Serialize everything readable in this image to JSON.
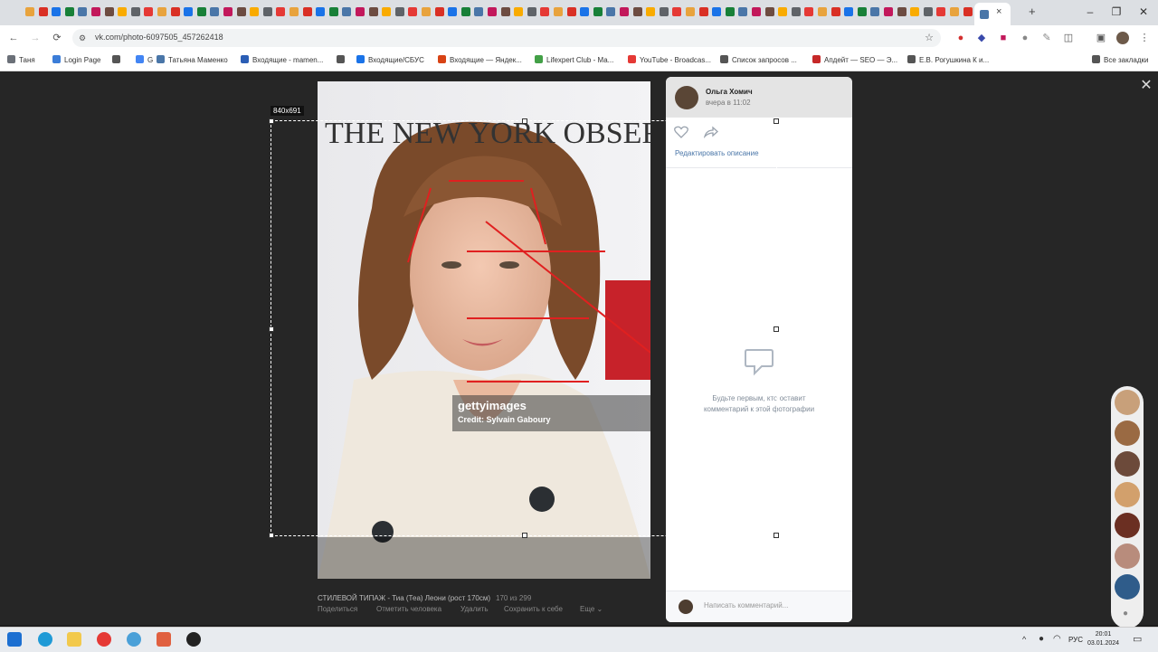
{
  "browser": {
    "url": "vk.com/photo-6097505_457262418",
    "tab_close": "×",
    "new_tab": "+",
    "window_controls": {
      "minimize": "–",
      "maximize": "❐",
      "close": "✕"
    },
    "bookmarks": [
      {
        "label": "Таня",
        "icon_color": "#6b7078"
      },
      {
        "label": "Login Page",
        "icon_color": "#3b7dd8"
      },
      {
        "label": "",
        "icon_color": "#555555"
      },
      {
        "label": "G",
        "icon_color": "#4285f4"
      },
      {
        "label": "Татьяна Маменко",
        "icon_color": "#4a76a8"
      },
      {
        "label": "Входящие - mamen...",
        "icon_color": "#2b5eb5"
      },
      {
        "label": "",
        "icon_color": "#555555"
      },
      {
        "label": "Входящие/СБУС",
        "icon_color": "#1a73e8"
      },
      {
        "label": "Входящие — Яндек...",
        "icon_color": "#d84315"
      },
      {
        "label": "Lifexpert Club - Ма...",
        "icon_color": "#43a047"
      },
      {
        "label": "YouTube - Broadcas...",
        "icon_color": "#e53935"
      },
      {
        "label": "Список запросов ...",
        "icon_color": "#555555"
      },
      {
        "label": "Апдейт — SEO — Э...",
        "icon_color": "#c62828"
      },
      {
        "label": "Е.В. Рогушкина К и...",
        "icon_color": "#555555"
      },
      {
        "label": "Все закладки",
        "icon_color": "#555555"
      }
    ]
  },
  "viewer": {
    "selection_size": "840x691",
    "getty_logo": "gettyimages",
    "getty_credit": "Credit: Sylvain Gaboury",
    "photo_watermark": "THE NEW YORK OBSERVER",
    "caption": "СТИЛЕВОЙ ТИПАЖ - Тиа (Теа) Леони (рост 170см)",
    "counter": "170 из 299",
    "actions": [
      "Поделиться",
      "Отметить человека",
      "Удалить",
      "Сохранить к себе",
      "Еще ⌄"
    ],
    "close": "✕"
  },
  "side_panel": {
    "author": "Ольга Хомич",
    "posted": "вчера в 11:02",
    "edit_description": "Редактировать описание",
    "empty_comments": "Будьте первым, кто оставит комментарий к этой фотографии",
    "comment_placeholder": "Написать комментарий..."
  },
  "taskbar": {
    "lang": "РУС",
    "time": "20:01",
    "date": "03.01.2024"
  },
  "colors": {
    "vk_blue": "#4a76a8",
    "overlay_dark": "#262626",
    "red_lines": "#e02020"
  }
}
